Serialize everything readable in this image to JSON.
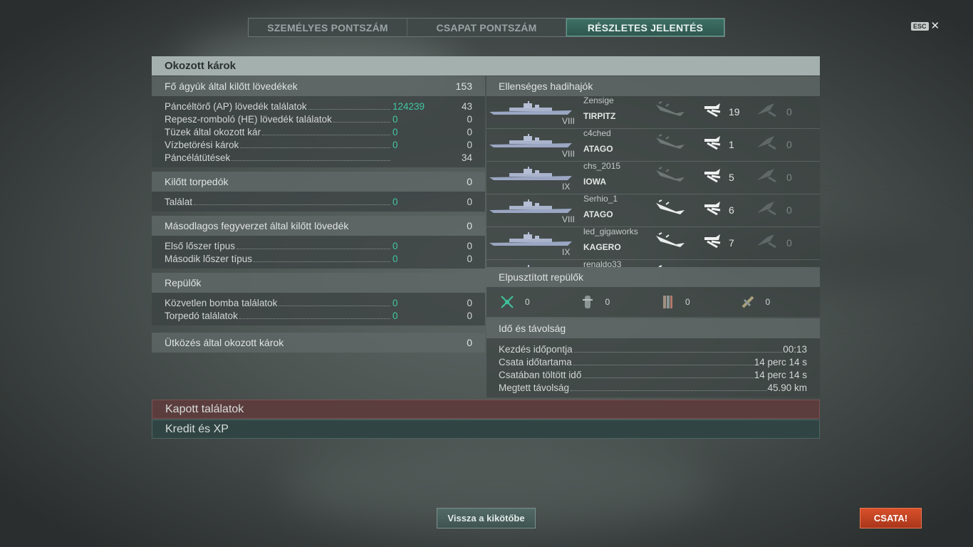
{
  "tabs": [
    {
      "label": "SZEMÉLYES PONTSZÁM",
      "active": false
    },
    {
      "label": "CSAPAT PONTSZÁM",
      "active": false
    },
    {
      "label": "RÉSZLETES JELENTÉS",
      "active": true
    }
  ],
  "esc_label": "ESC",
  "header": "Okozott károk",
  "left": {
    "main_guns": {
      "label": "Fő ágyúk által kilőtt lövedékek",
      "value": "153",
      "rows": [
        {
          "label": "Páncéltörő (AP) lövedék találatok",
          "green": "124239",
          "value": "43"
        },
        {
          "label": "Repesz-romboló (HE) lövedék találatok",
          "green": "0",
          "value": "0"
        },
        {
          "label": "Tüzek által okozott kár",
          "green": "0",
          "value": "0"
        },
        {
          "label": "Vízbetörési károk",
          "green": "0",
          "value": "0"
        },
        {
          "label": "Páncélátütések",
          "green": "",
          "value": "34"
        }
      ]
    },
    "torpedoes": {
      "label": "Kilőtt torpedók",
      "value": "0",
      "rows": [
        {
          "label": "Találat",
          "green": "0",
          "value": "0"
        }
      ]
    },
    "secondary": {
      "label": "Másodlagos fegyverzet által kilőtt lövedék",
      "value": "0",
      "rows": [
        {
          "label": "Első lőszer típus",
          "green": "0",
          "value": "0"
        },
        {
          "label": "Második lőszer típus",
          "green": "0",
          "value": "0"
        }
      ]
    },
    "planes": {
      "label": "Repülők",
      "rows": [
        {
          "label": "Közvetlen bomba találatok",
          "green": "0",
          "value": "0"
        },
        {
          "label": "Torpedó találatok",
          "green": "0",
          "value": "0"
        }
      ]
    },
    "ramming": {
      "label": "Ütközés által okozott károk",
      "value": "0"
    }
  },
  "right": {
    "enemy_title": "Ellenséges hadihajók",
    "ships": [
      {
        "tier": "VIII",
        "player": "Zensige",
        "ship": "TIRPITZ",
        "hits": "19",
        "torp": "0",
        "sunk": false
      },
      {
        "tier": "VIII",
        "player": "c4ched",
        "ship": "ATAGO",
        "hits": "1",
        "torp": "0",
        "sunk": false
      },
      {
        "tier": "IX",
        "player": "chs_2015",
        "ship": "IOWA",
        "hits": "5",
        "torp": "0",
        "sunk": false
      },
      {
        "tier": "VIII",
        "player": "Serhio_1",
        "ship": "ATAGO",
        "hits": "6",
        "torp": "0",
        "sunk": true
      },
      {
        "tier": "IX",
        "player": "led_gigaworks",
        "ship": "KAGERO",
        "hits": "7",
        "torp": "0",
        "sunk": true
      },
      {
        "tier": "",
        "player": "renaldo33",
        "ship": "",
        "hits": "",
        "torp": "",
        "sunk": true
      }
    ],
    "planes_title": "Elpusztított repülők",
    "planes": [
      {
        "icon": "fighter-icon",
        "value": "0"
      },
      {
        "icon": "bomber-icon",
        "value": "0"
      },
      {
        "icon": "torpedo-bomber-icon",
        "value": "0"
      },
      {
        "icon": "dive-bomber-icon",
        "value": "0"
      }
    ],
    "time_title": "Idő és távolság",
    "time_rows": [
      {
        "label": "Kezdés időpontja",
        "value": "00:13"
      },
      {
        "label": "Csata időtartama",
        "value": "14 perc 14 s"
      },
      {
        "label": "Csatában töltött idő",
        "value": "14 perc 14 s"
      },
      {
        "label": "Megtett távolság",
        "value": "45.90 km"
      }
    ]
  },
  "bars": {
    "received": "Kapott találatok",
    "credits": "Kredit és XP"
  },
  "buttons": {
    "back": "Vissza a kikötőbe",
    "battle": "CSATA!"
  },
  "colors": {
    "accent_green": "#40c79e",
    "battle_button": "#c9461f",
    "active_tab": "#3a685f"
  }
}
